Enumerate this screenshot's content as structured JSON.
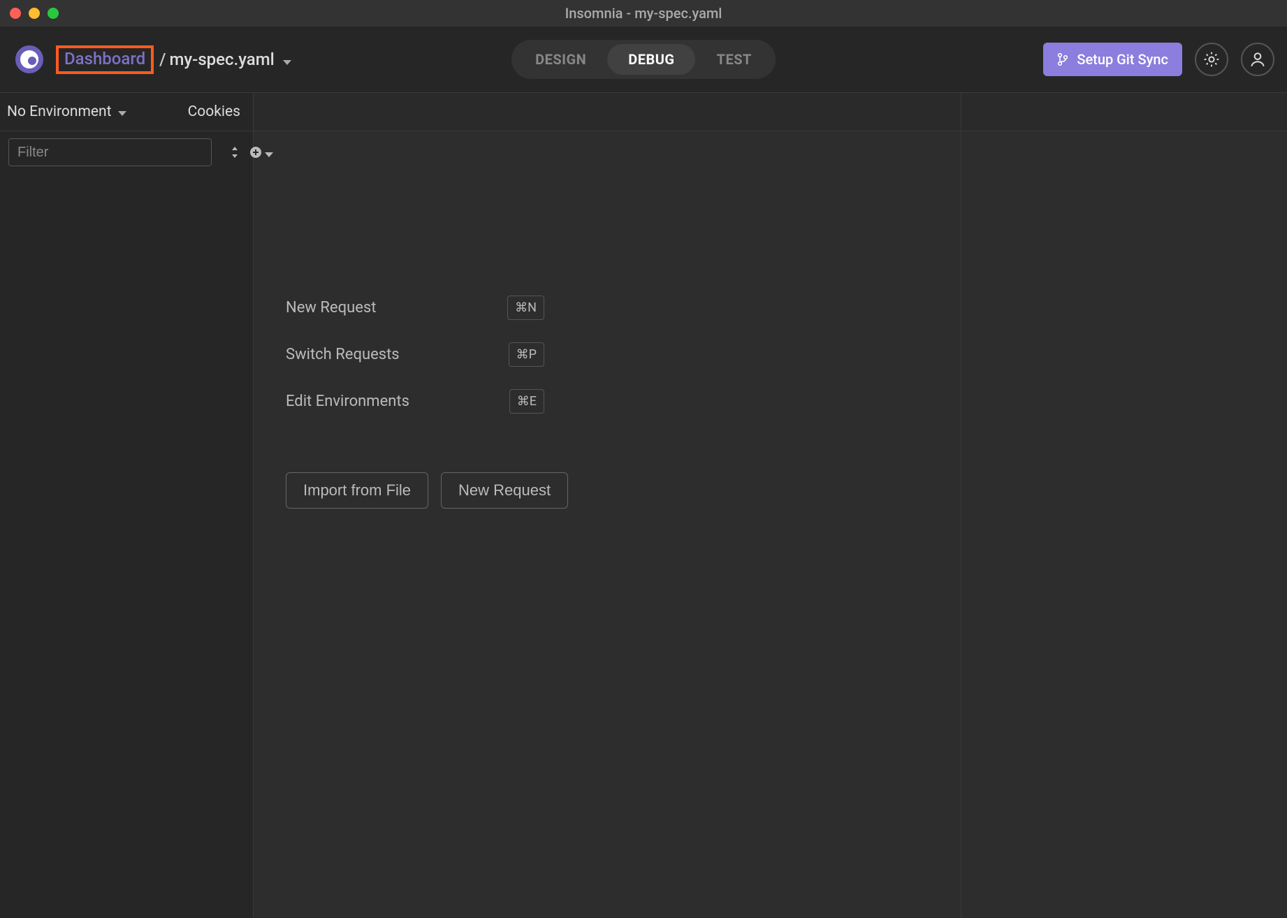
{
  "titlebar": {
    "title": "Insomnia - my-spec.yaml"
  },
  "header": {
    "breadcrumb": {
      "dashboard": "Dashboard",
      "separator": "/",
      "file": "my-spec.yaml"
    },
    "tabs": {
      "design": "DESIGN",
      "debug": "DEBUG",
      "test": "TEST",
      "active": "debug"
    },
    "git_sync": "Setup Git Sync"
  },
  "sidebar": {
    "environment": "No Environment",
    "cookies": "Cookies",
    "filter_placeholder": "Filter"
  },
  "empty_state": {
    "shortcuts": [
      {
        "label": "New Request",
        "key": "⌘N"
      },
      {
        "label": "Switch Requests",
        "key": "⌘P"
      },
      {
        "label": "Edit Environments",
        "key": "⌘E"
      }
    ],
    "import_btn": "Import from File",
    "new_request_btn": "New Request"
  }
}
